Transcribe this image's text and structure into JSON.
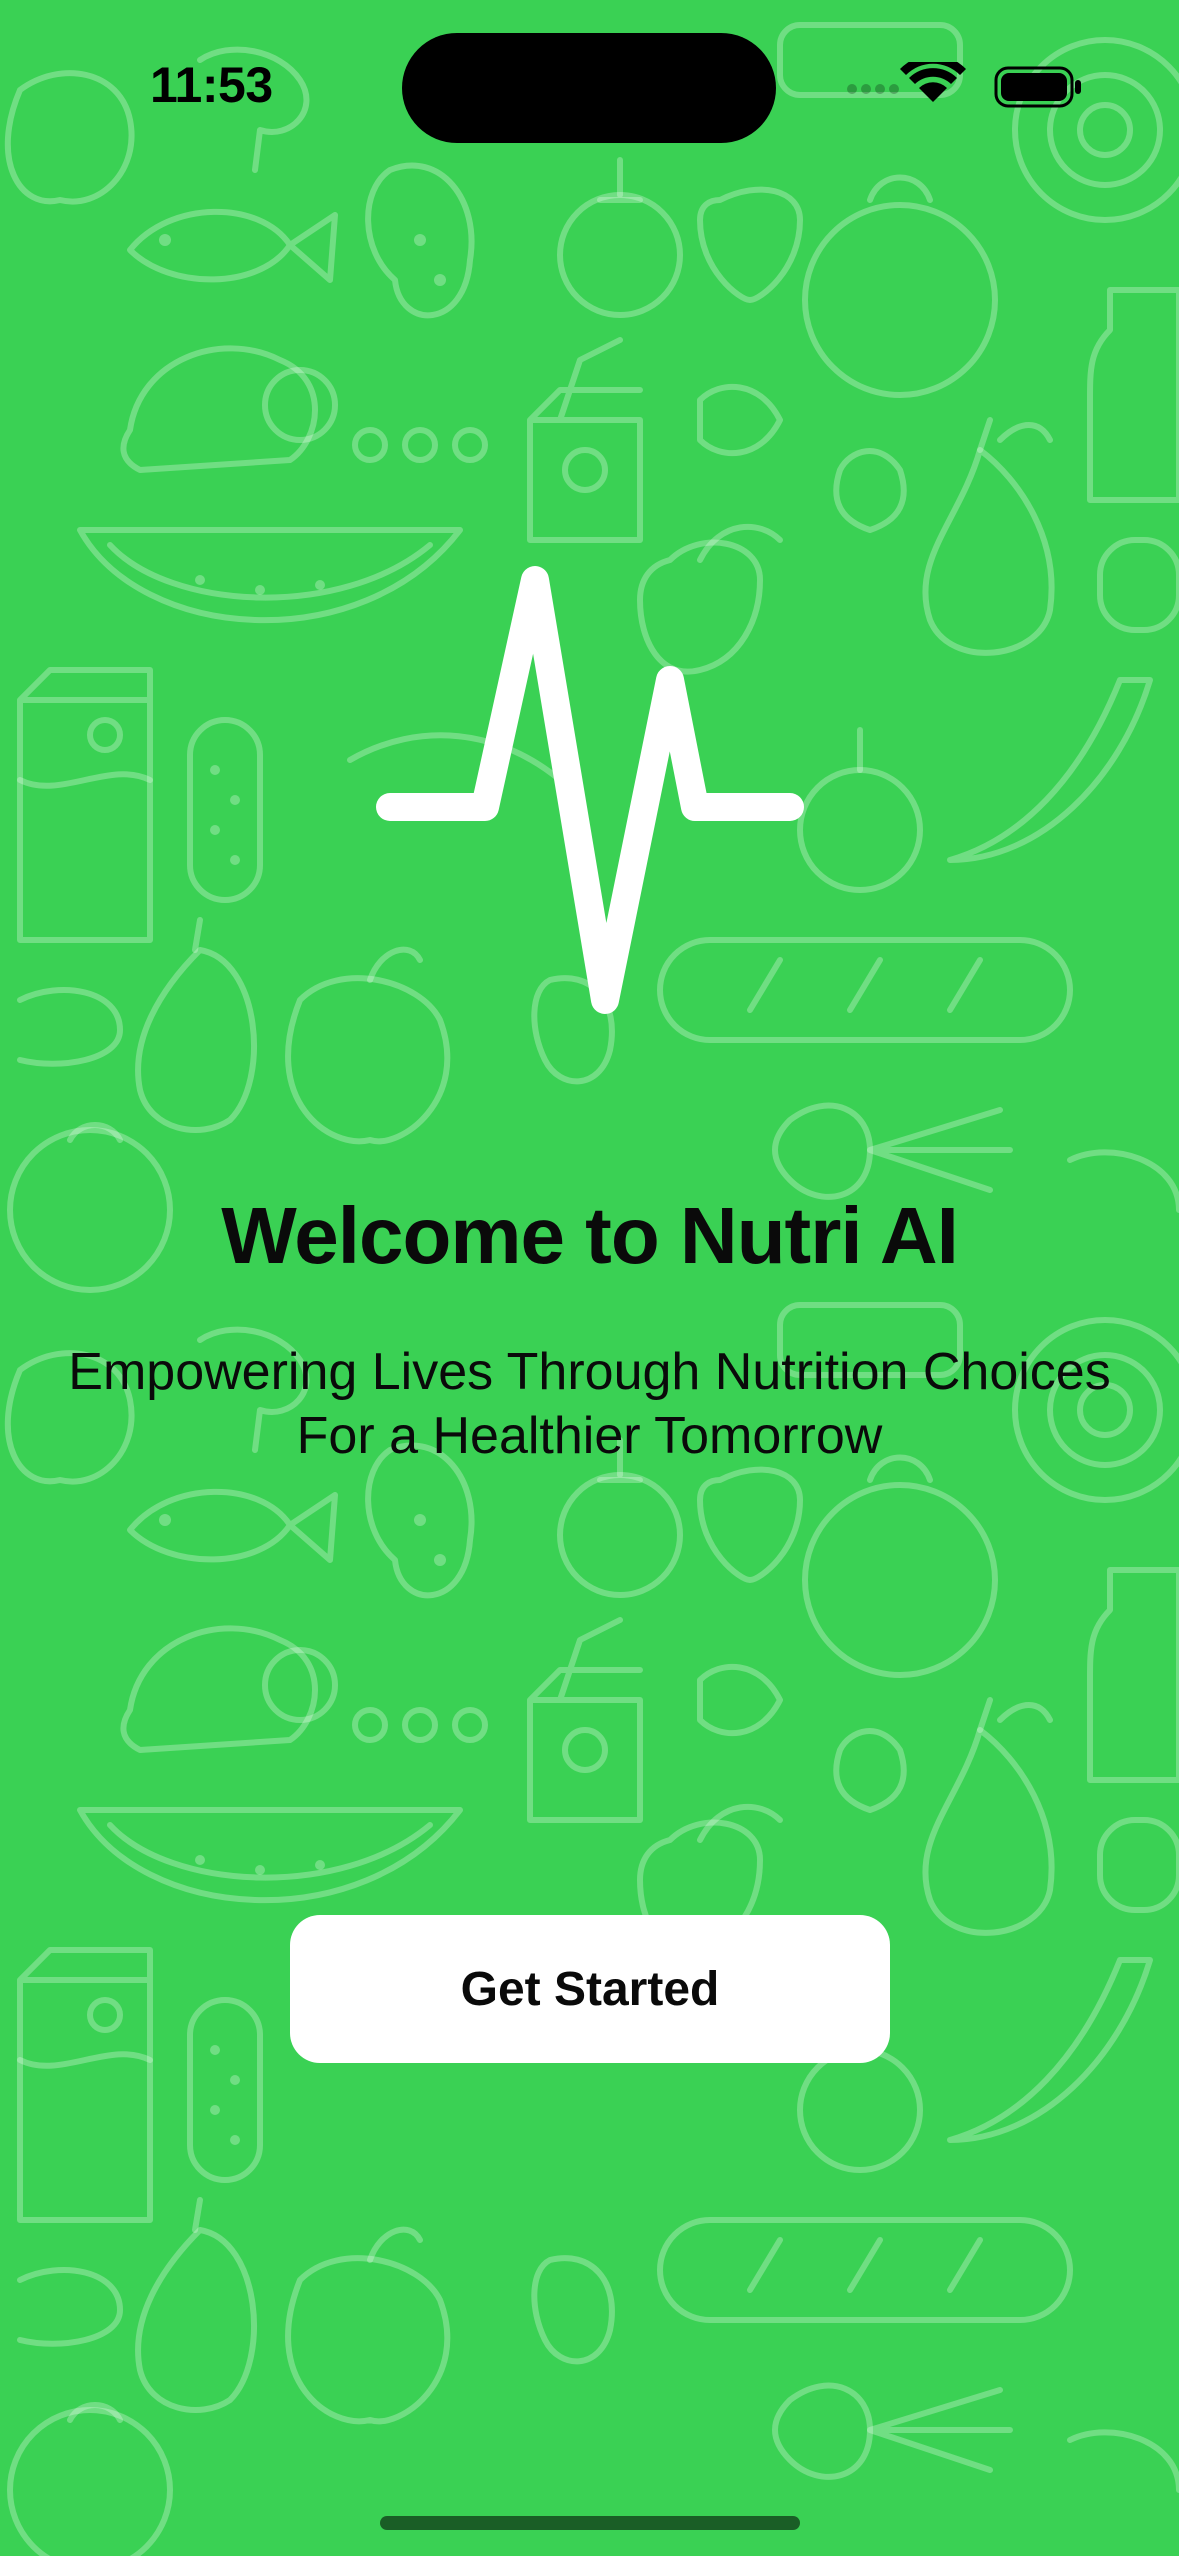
{
  "status_bar": {
    "time": "11:53",
    "icons": [
      "wifi-icon",
      "battery-icon"
    ]
  },
  "logo": {
    "icon": "pulse-icon"
  },
  "welcome": {
    "title": "Welcome to Nutri AI",
    "subtitle_line1": "Empowering Lives Through Nutrition Choices",
    "subtitle_line2": "For a Healthier Tomorrow"
  },
  "actions": {
    "get_started_label": "Get Started"
  },
  "colors": {
    "background": "#3ad154",
    "button_bg": "#ffffff",
    "text": "#0a0a0a"
  },
  "background_pattern": {
    "icon": "food-doodle-pattern"
  }
}
